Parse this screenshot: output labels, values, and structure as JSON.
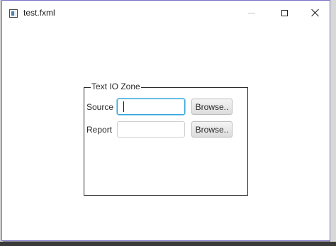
{
  "window": {
    "title": "test.fxml",
    "icon": "app-icon",
    "controls": [
      "minimize-icon",
      "maximize-icon",
      "close-icon"
    ]
  },
  "group": {
    "legend": "Text IO Zone",
    "rows": [
      {
        "label": "Source",
        "value": "",
        "button": "Browse..",
        "focused": true
      },
      {
        "label": "Report",
        "value": "",
        "button": "Browse..",
        "focused": false
      }
    ]
  },
  "colors": {
    "focus_border": "#35a3d8",
    "window_border": "#7b73c9"
  }
}
